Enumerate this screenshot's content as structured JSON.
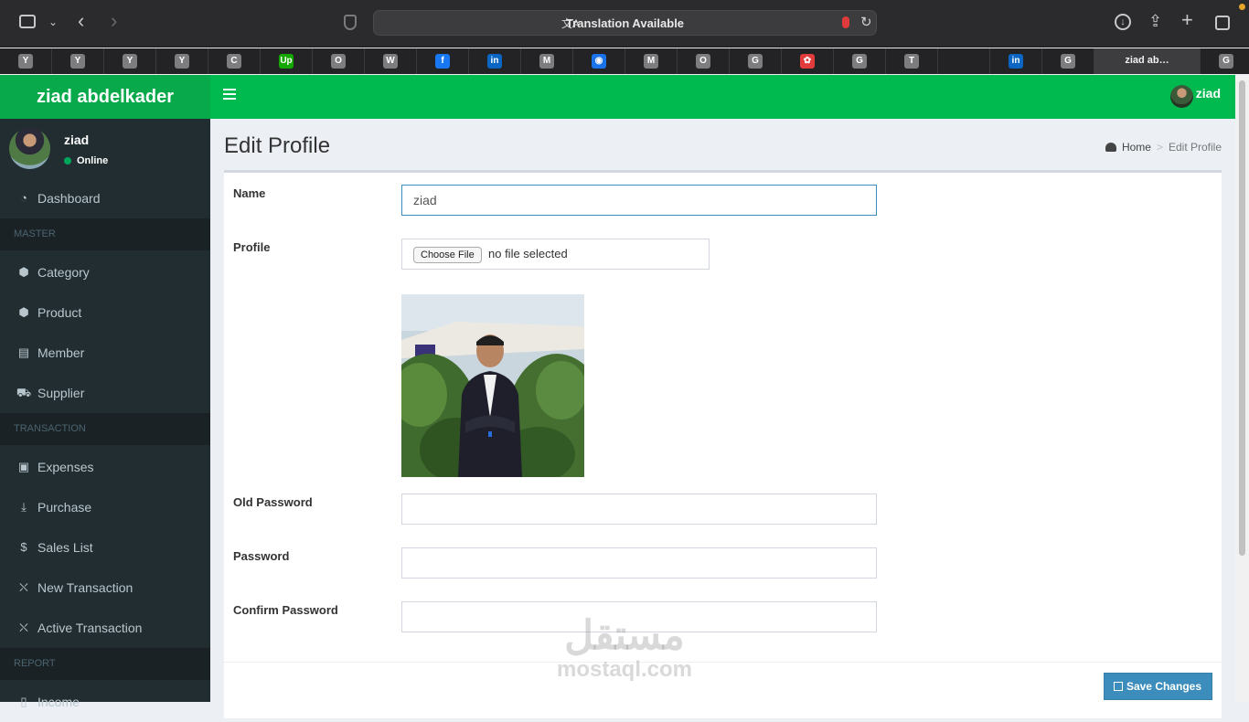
{
  "browser": {
    "address_text": "Translation Available",
    "tabs": [
      "Y",
      "Y",
      "Y",
      "Y",
      "C",
      "Up",
      "O",
      "W",
      "f",
      "in",
      "M",
      "◉",
      "M",
      "O",
      "G",
      "✿",
      "G",
      "T",
      "",
      "in",
      "G",
      "ziad ab…",
      "G"
    ],
    "active_tab_title": "ziad ab…"
  },
  "app": {
    "brand": "ziad abdelkader",
    "nav_user": "ziad",
    "accent_color": "#00b94f",
    "sidebar_bg": "#222d32"
  },
  "sidebar": {
    "user_name": "ziad",
    "user_status": "Online",
    "items": [
      {
        "label": "Dashboard",
        "icon": "dashboard-icon"
      },
      {
        "header": "MASTER"
      },
      {
        "label": "Category",
        "icon": "cube-icon"
      },
      {
        "label": "Product",
        "icon": "cubes-icon"
      },
      {
        "label": "Member",
        "icon": "id-card-icon"
      },
      {
        "label": "Supplier",
        "icon": "truck-icon"
      },
      {
        "header": "TRANSACTION"
      },
      {
        "label": "Expenses",
        "icon": "money-icon"
      },
      {
        "label": "Purchase",
        "icon": "download-icon"
      },
      {
        "label": "Sales List",
        "icon": "dollar-icon"
      },
      {
        "label": "New Transaction",
        "icon": "cart-icon"
      },
      {
        "label": "Active Transaction",
        "icon": "cart-icon"
      },
      {
        "header": "REPORT"
      },
      {
        "label": "Income",
        "icon": "file-icon"
      }
    ]
  },
  "page": {
    "title": "Edit Profile",
    "breadcrumb_home": "Home",
    "breadcrumb_current": "Edit Profile"
  },
  "form": {
    "name_label": "Name",
    "name_value": "ziad",
    "profile_label": "Profile",
    "choose_file": "Choose File",
    "no_file": "no file selected",
    "old_password_label": "Old Password",
    "password_label": "Password",
    "confirm_password_label": "Confirm Password",
    "save_button": "Save Changes"
  },
  "watermark": {
    "arabic": "مستقل",
    "latin": "mostaql.com"
  }
}
